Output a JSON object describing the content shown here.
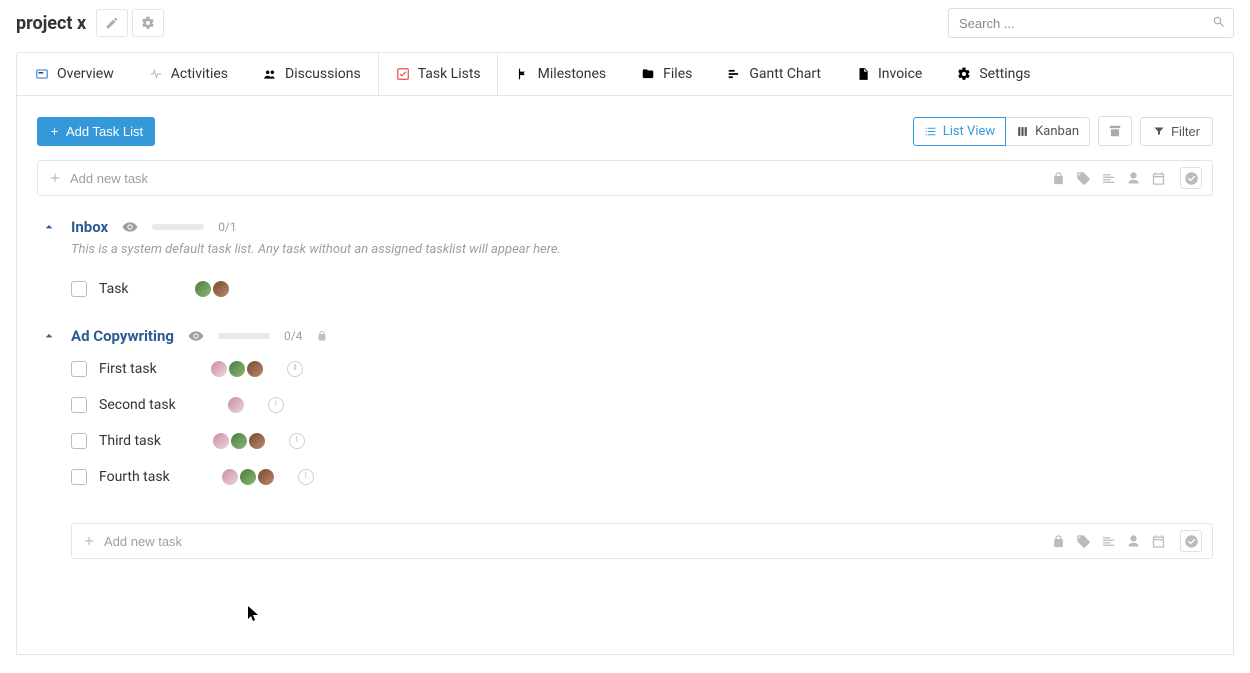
{
  "header": {
    "project_title": "project x",
    "search_placeholder": "Search ..."
  },
  "tabs": [
    {
      "key": "overview",
      "label": "Overview",
      "icon": "card",
      "color": "#3b87d9"
    },
    {
      "key": "activities",
      "label": "Activities",
      "icon": "pulse",
      "color": "#bfbfbf"
    },
    {
      "key": "discussions",
      "label": "Discussions",
      "icon": "people",
      "color": "#3aa860"
    },
    {
      "key": "task-lists",
      "label": "Task Lists",
      "icon": "check",
      "color": "#e94b4b",
      "active": true
    },
    {
      "key": "milestones",
      "label": "Milestones",
      "icon": "flag",
      "color": "#9a6fd1"
    },
    {
      "key": "files",
      "label": "Files",
      "icon": "folder",
      "color": "#f0a537"
    },
    {
      "key": "gantt",
      "label": "Gantt Chart",
      "icon": "bars",
      "color": "#bfbfbf"
    },
    {
      "key": "invoice",
      "label": "Invoice",
      "icon": "doc",
      "color": "#333333"
    },
    {
      "key": "settings",
      "label": "Settings",
      "icon": "gear",
      "color": "#bfbfbf"
    }
  ],
  "toolbar": {
    "add_task_list": "Add Task List",
    "list_view": "List View",
    "kanban": "Kanban",
    "filter": "Filter"
  },
  "add_task_placeholder": "Add new task",
  "lists": [
    {
      "title": "Inbox",
      "count": "0/1",
      "desc": "This is a system default task list. Any task without an assigned tasklist will appear here.",
      "locked": false,
      "tasks": [
        {
          "title": "Task",
          "assignees": [
            "a2",
            "a3"
          ],
          "timer": false
        }
      ],
      "add_row": false
    },
    {
      "title": "Ad Copywriting",
      "count": "0/4",
      "desc": "",
      "locked": true,
      "tasks": [
        {
          "title": "First task",
          "assignees": [
            "a1",
            "a2",
            "a3"
          ],
          "timer": true
        },
        {
          "title": "Second task",
          "assignees": [
            "a1"
          ],
          "timer": true
        },
        {
          "title": "Third task",
          "assignees": [
            "a1",
            "a2",
            "a3"
          ],
          "timer": true
        },
        {
          "title": "Fourth task",
          "assignees": [
            "a1",
            "a2",
            "a3"
          ],
          "timer": true
        }
      ],
      "add_row": true
    }
  ]
}
